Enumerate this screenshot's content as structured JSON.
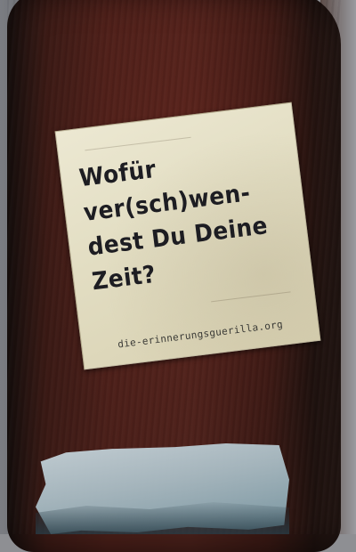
{
  "photo": {
    "subject": "sticker-on-wooden-pole",
    "sticker": {
      "lines": [
        "Wofür",
        "ver(sch)wen-",
        "dest Du Deine",
        "Zeit?"
      ],
      "url": "die-erinnerungsguerilla.org"
    },
    "colors": {
      "pole": "#4a1f19",
      "sticker_paper": "#e6e1c8",
      "text": "#1d1d22",
      "torn_sticker": "#a9bcc4"
    }
  }
}
